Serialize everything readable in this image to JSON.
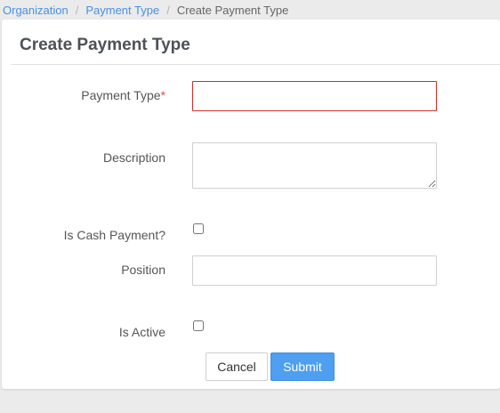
{
  "breadcrumb": {
    "items": [
      "Organization",
      "Payment Type"
    ],
    "current": "Create Payment Type",
    "separator": "/"
  },
  "form": {
    "title": "Create Payment Type",
    "fields": {
      "payment_type": {
        "label": "Payment Type",
        "required_marker": "*",
        "value": ""
      },
      "description": {
        "label": "Description",
        "value": ""
      },
      "is_cash_payment": {
        "label": "Is Cash Payment?",
        "checked": false
      },
      "position": {
        "label": "Position",
        "value": ""
      },
      "is_active": {
        "label": "Is Active",
        "checked": false
      }
    },
    "buttons": {
      "cancel_label": "Cancel",
      "submit_label": "Submit"
    }
  },
  "colors": {
    "accent": "#4e9ff0",
    "link": "#4a90e2",
    "error_border": "#c9302c",
    "required": "#d9534f"
  }
}
